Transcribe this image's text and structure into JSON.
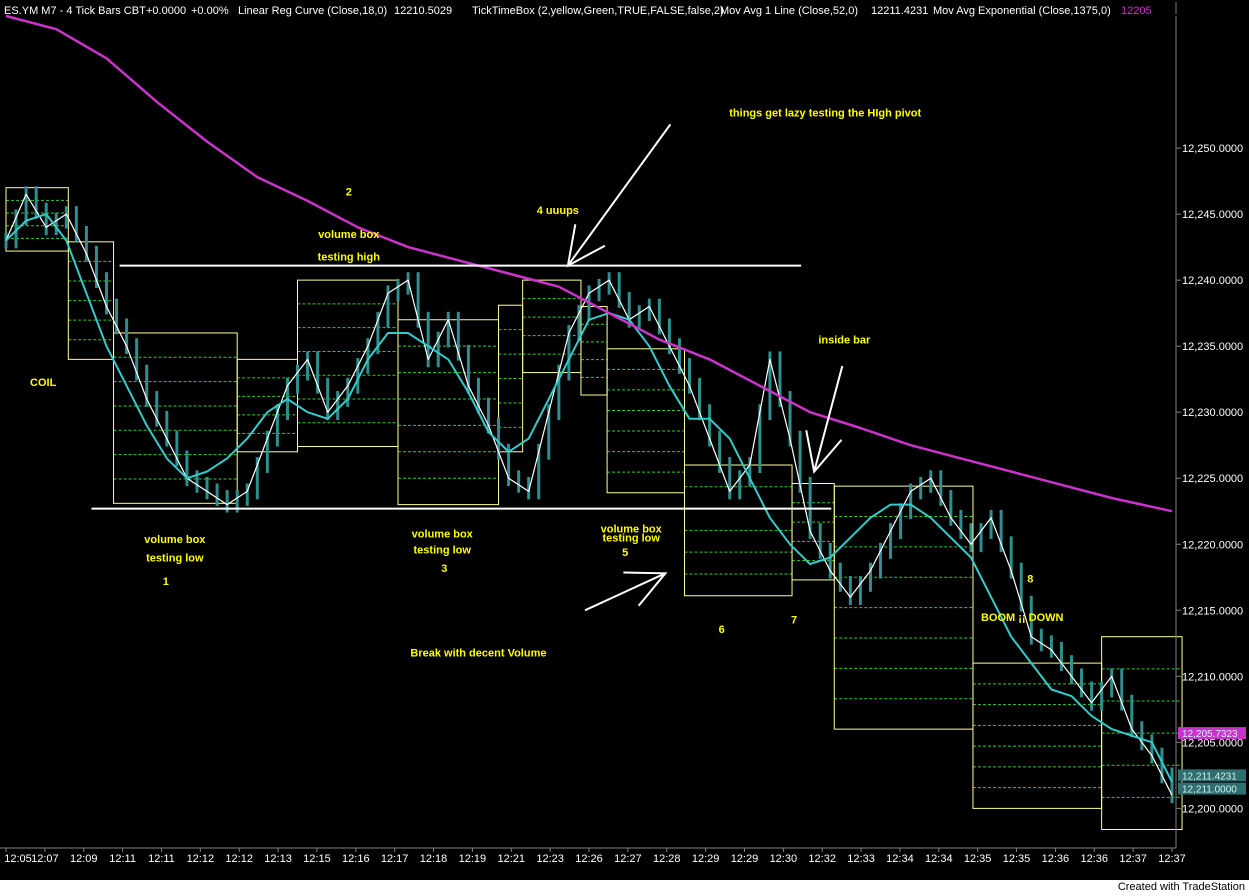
{
  "header": {
    "symbol": "ES.YM M7 - 4 Tick Bars  CBT",
    "change": "+0.0000",
    "change_pct": "+0.00%",
    "ind1": "Linear Reg Curve  (Close,18,0)",
    "ind1_val": "12210.5029",
    "ind2": "TickTimeBox  (2,yellow,Green,TRUE,FALSE,false,2)",
    "ind3": "Mov Avg 1 Line  (Close,52,0)",
    "ind3_val": "12211.4231",
    "ind4": "Mov Avg Exponential  (Close,1375,0)",
    "ind4_val": "12205"
  },
  "footer": {
    "text": "Created with TradeStation"
  },
  "colors": {
    "background": "#000000",
    "price": "#ffffff",
    "ma52": "#33cccc",
    "ema1375": "#cc33cc",
    "box": "#ffff99",
    "box_grid": "#33cc33",
    "annotation": "#ffff00",
    "bars": "#2f8f8f"
  },
  "chart_data": {
    "type": "line",
    "ylim": [
      12197,
      12260
    ],
    "y_ticks": [
      "12,250.0000",
      "12,245.0000",
      "12,240.0000",
      "12,235.0000",
      "12,230.0000",
      "12,225.0000",
      "12,220.0000",
      "12,215.0000",
      "12,210.0000",
      "12,205.0000",
      "12,200.0000"
    ],
    "y_tick_values": [
      12250,
      12245,
      12240,
      12235,
      12230,
      12225,
      12220,
      12215,
      12210,
      12205,
      12200
    ],
    "x_ticks": [
      "12:05",
      "12:07",
      "12:09",
      "12:11",
      "12:11",
      "12:12",
      "12:12",
      "12:13",
      "12:15",
      "12:16",
      "12:17",
      "12:18",
      "12:19",
      "12:21",
      "12:23",
      "12:26",
      "12:27",
      "12:28",
      "12:29",
      "12:29",
      "12:30",
      "12:32",
      "12:33",
      "12:34",
      "12:34",
      "12:35",
      "12:35",
      "12:36",
      "12:36",
      "12:37",
      "12:37"
    ],
    "n_bars": 117,
    "last_values": {
      "linreg": "12,211.4231",
      "ma": "12,211.0000",
      "ema": "12,205.7323"
    },
    "series": [
      {
        "name": "Close",
        "x": [
          0,
          2,
          4,
          6,
          8,
          10,
          12,
          14,
          16,
          18,
          20,
          22,
          24,
          26,
          28,
          30,
          32,
          34,
          36,
          38,
          40,
          42,
          44,
          46,
          48,
          50,
          52,
          54,
          56,
          58,
          60,
          62,
          64,
          66,
          68,
          70,
          72,
          74,
          76,
          78,
          80,
          82,
          84,
          86,
          88,
          90,
          92,
          94,
          96,
          98,
          100,
          102,
          104,
          106,
          108,
          110,
          112,
          114,
          116
        ],
        "values": [
          12243,
          12246.5,
          12244,
          12245,
          12242,
          12238,
          12235,
          12231,
          12228,
          12225,
          12224,
          12223,
          12224,
          12228,
          12232,
          12234,
          12230,
          12232,
          12235,
          12239,
          12240,
          12234,
          12237,
          12232,
          12229,
          12225,
          12224,
          12230,
          12236,
          12239,
          12240,
          12237,
          12238,
          12235,
          12232,
          12228,
          12224,
          12226,
          12234,
          12228,
          12221,
          12218,
          12216,
          12218,
          12221,
          12224,
          12225,
          12222,
          12220,
          12222,
          12218,
          12213,
          12212,
          12210,
          12208,
          12210,
          12206,
          12204,
          12201
        ]
      },
      {
        "name": "Mov Avg 1 Line",
        "x": [
          0,
          2,
          4,
          6,
          8,
          10,
          12,
          14,
          16,
          18,
          20,
          22,
          24,
          26,
          28,
          30,
          32,
          34,
          36,
          38,
          40,
          42,
          44,
          46,
          48,
          50,
          52,
          54,
          56,
          58,
          60,
          62,
          64,
          66,
          68,
          70,
          72,
          74,
          76,
          78,
          80,
          82,
          84,
          86,
          88,
          90,
          92,
          94,
          96,
          98,
          100,
          102,
          104,
          106,
          108,
          110,
          112,
          114,
          116
        ],
        "values": [
          12243,
          12244.5,
          12245,
          12243,
          12239,
          12235,
          12232,
          12229,
          12226.5,
          12225,
          12225.5,
          12226.5,
          12228,
          12230,
          12231,
          12230,
          12229.5,
          12231,
          12234,
          12236,
          12236,
          12235,
          12234,
          12231.5,
          12228.5,
          12227,
          12228,
          12231,
          12234,
          12237,
          12237.5,
          12237,
          12235,
          12232,
          12229.5,
          12229.5,
          12228,
          12225,
          12222,
          12220,
          12218.5,
          12219,
          12220.5,
          12222,
          12223,
          12223,
          12222,
          12220.5,
          12219,
          12216,
          12213,
          12211,
          12209,
          12208.5,
          12207,
          12206,
          12205.5,
          12205,
          12202
        ]
      },
      {
        "name": "Mov Avg Exponential",
        "x": [
          0,
          5,
          10,
          15,
          20,
          25,
          30,
          35,
          40,
          45,
          50,
          55,
          60,
          65,
          70,
          75,
          80,
          85,
          90,
          95,
          100,
          105,
          110,
          116
        ],
        "values": [
          12260,
          12259,
          12256.8,
          12253.5,
          12250.5,
          12247.8,
          12246,
          12244,
          12242.5,
          12241.5,
          12240.5,
          12239.5,
          12237.5,
          12235.5,
          12234,
          12232,
          12230,
          12228.8,
          12227.5,
          12226.5,
          12225.5,
          12224.5,
          12223.5,
          12222.5
        ]
      }
    ],
    "annotations": [
      {
        "text": "COIL",
        "bar": 3.7,
        "value": 12232.3
      },
      {
        "text": "2",
        "bar": 34.1,
        "value": 12246.7
      },
      {
        "text": "volume box",
        "bar": 34.1,
        "value": 12243.5
      },
      {
        "text": "testing high",
        "bar": 34.1,
        "value": 12241.8
      },
      {
        "text": "4  uuups",
        "bar": 54.9,
        "value": 12245.3
      },
      {
        "text": "things get lazy testing the HIgh pivot",
        "bar": 81.5,
        "value": 12252.7
      },
      {
        "text": "inside bar",
        "bar": 83.4,
        "value": 12235.5
      },
      {
        "text": "volume box",
        "bar": 16.8,
        "value": 12220.4
      },
      {
        "text": "testing low",
        "bar": 16.8,
        "value": 12219.0
      },
      {
        "text": "1",
        "bar": 15.9,
        "value": 12217.2
      },
      {
        "text": "volume box",
        "bar": 43.4,
        "value": 12220.8
      },
      {
        "text": "testing low",
        "bar": 43.4,
        "value": 12219.6
      },
      {
        "text": "3",
        "bar": 43.6,
        "value": 12218.2
      },
      {
        "text": "volume box",
        "bar": 62.2,
        "value": 12221.2
      },
      {
        "text": "testing low",
        "bar": 62.2,
        "value": 12220.5
      },
      {
        "text": "5",
        "bar": 61.6,
        "value": 12219.4
      },
      {
        "text": "6",
        "bar": 71.2,
        "value": 12213.6
      },
      {
        "text": "7",
        "bar": 78.4,
        "value": 12214.3
      },
      {
        "text": "8",
        "bar": 101.9,
        "value": 12217.4
      },
      {
        "text": "BOOM ¡¡ DOWN",
        "bar": 101.1,
        "value": 12214.5
      },
      {
        "text": "Break with decent Volume",
        "bar": 47.0,
        "value": 12211.8
      }
    ],
    "boxes": [
      {
        "b0": 0.0,
        "b1": 6.2,
        "lo": 12242.2,
        "hi": 12247.0,
        "n": 5
      },
      {
        "b0": 6.2,
        "b1": 10.7,
        "lo": 12234.0,
        "hi": 12242.9,
        "n": 6
      },
      {
        "b0": 10.7,
        "b1": 23.0,
        "lo": 12223.1,
        "hi": 12236.0,
        "n": 7
      },
      {
        "b0": 23.0,
        "b1": 29.0,
        "lo": 12227.0,
        "hi": 12234.0,
        "n": 5
      },
      {
        "b0": 29.0,
        "b1": 39.0,
        "lo": 12227.4,
        "hi": 12240.0,
        "n": 7
      },
      {
        "b0": 39.0,
        "b1": 49.0,
        "lo": 12223.0,
        "hi": 12237.0,
        "n": 7
      },
      {
        "b0": 49.0,
        "b1": 51.4,
        "lo": 12227.0,
        "hi": 12238.1,
        "n": 6
      },
      {
        "b0": 51.4,
        "b1": 57.2,
        "lo": 12233.0,
        "hi": 12240.0,
        "n": 5
      },
      {
        "b0": 57.2,
        "b1": 59.8,
        "lo": 12231.3,
        "hi": 12238.0,
        "n": 5
      },
      {
        "b0": 59.8,
        "b1": 67.5,
        "lo": 12223.9,
        "hi": 12234.8,
        "n": 7
      },
      {
        "b0": 67.5,
        "b1": 78.2,
        "lo": 12216.1,
        "hi": 12226.0,
        "n": 6
      },
      {
        "b0": 78.2,
        "b1": 82.4,
        "lo": 12217.3,
        "hi": 12224.6,
        "n": 5
      },
      {
        "b0": 82.4,
        "b1": 96.2,
        "lo": 12206.0,
        "hi": 12224.4,
        "n": 8
      },
      {
        "b0": 96.2,
        "b1": 109.0,
        "lo": 12200.0,
        "hi": 12211.0,
        "n": 7
      },
      {
        "b0": 109.0,
        "b1": 117.0,
        "lo": 12198.4,
        "hi": 12213.0,
        "n": 6
      }
    ],
    "lines": [
      {
        "b0": 11.3,
        "b1": 79.1,
        "value": 12241.1
      },
      {
        "b0": 8.5,
        "b1": 82.1,
        "value": 12222.7
      }
    ],
    "arrows": [
      {
        "fb": 66.1,
        "fv": 12251.8,
        "tb": 55.9,
        "tv": 12241.1
      },
      {
        "fb": 83.2,
        "fv": 12233.5,
        "tb": 80.4,
        "tv": 12225.5
      },
      {
        "fb": 57.6,
        "fv": 12215.0,
        "tb": 65.6,
        "tv": 12217.8
      }
    ]
  }
}
